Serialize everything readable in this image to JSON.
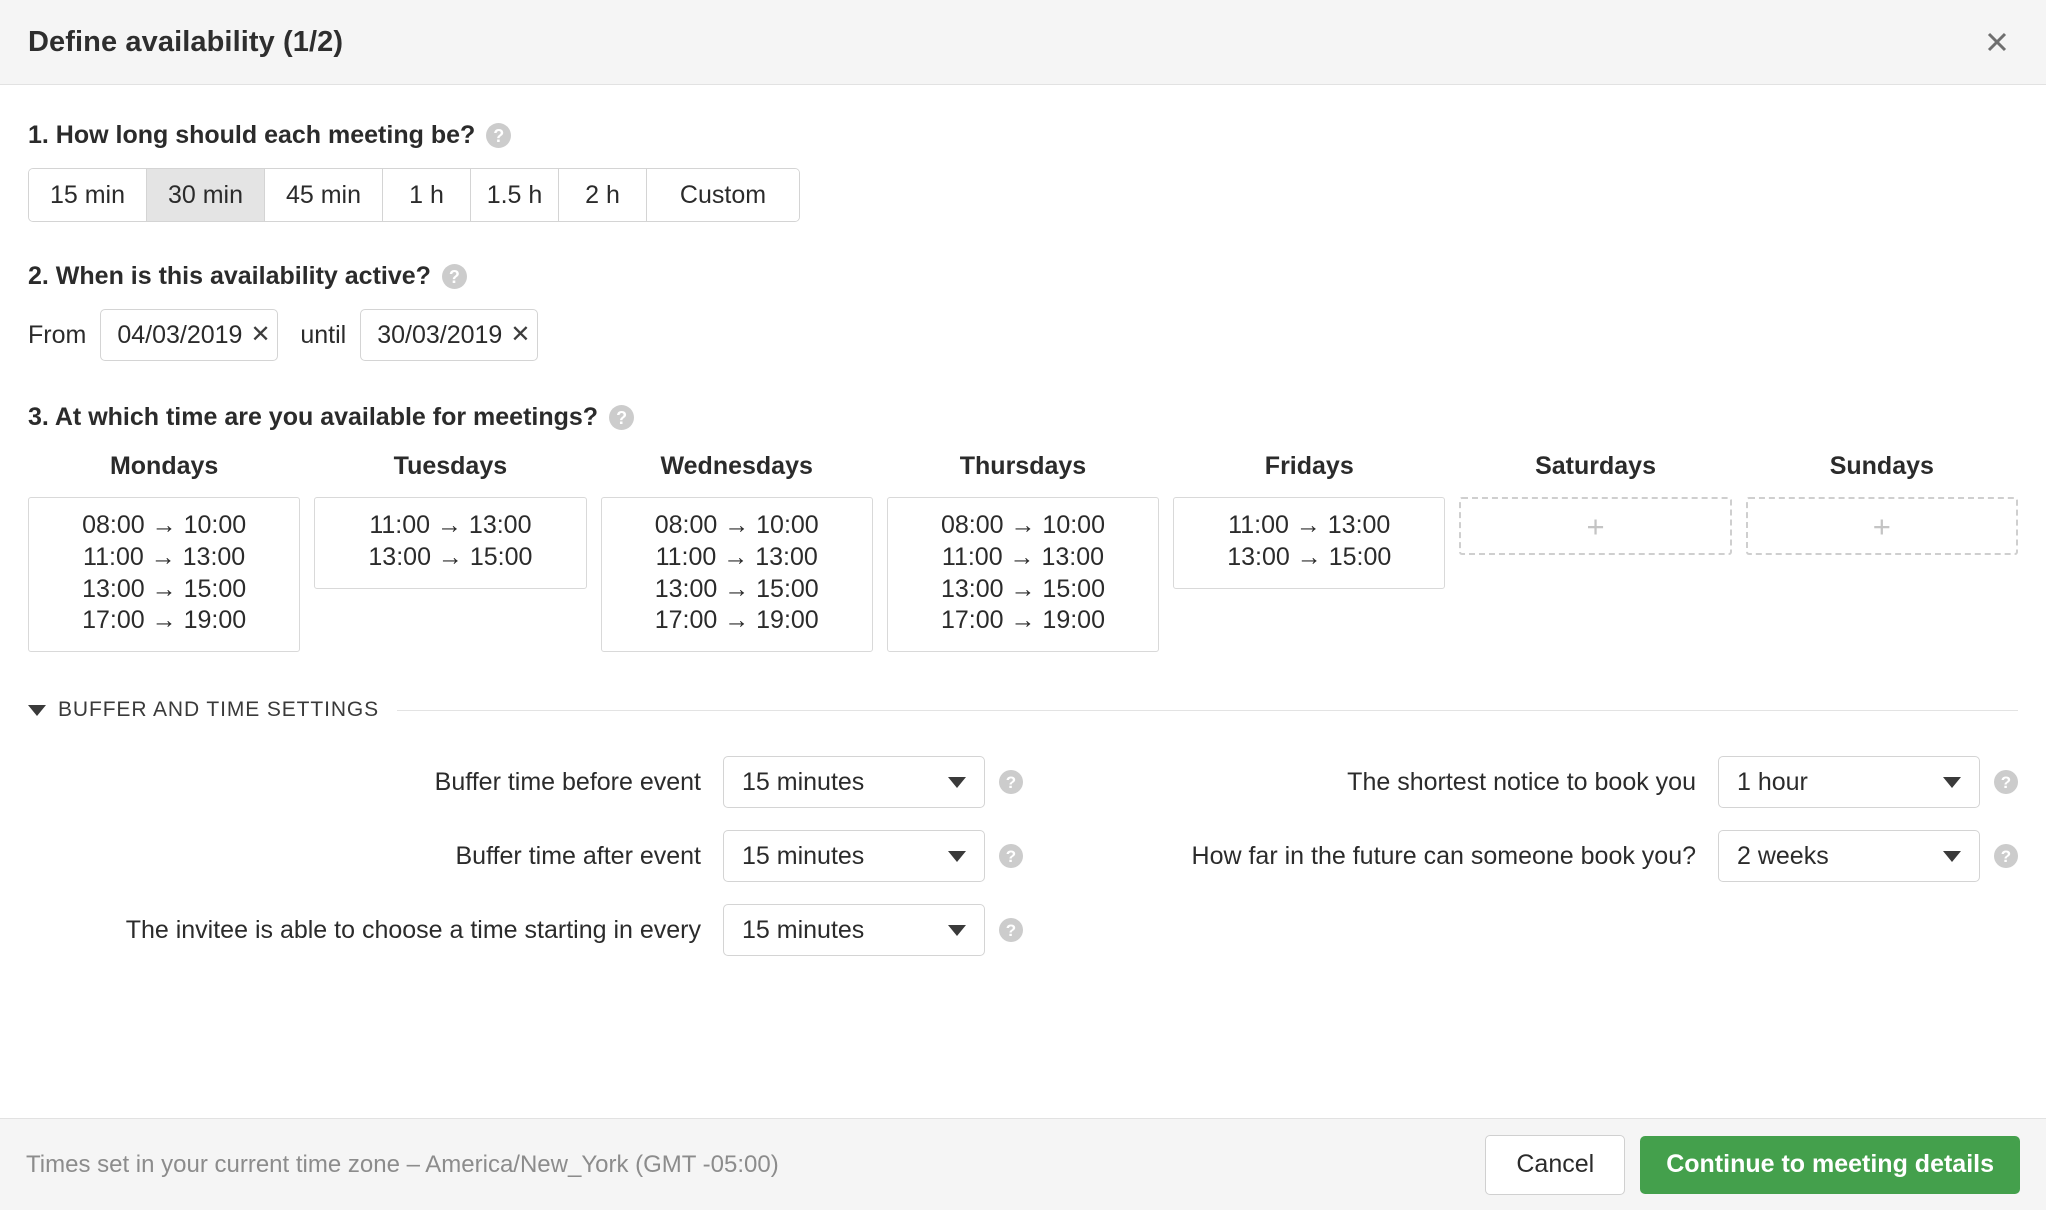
{
  "header": {
    "title": "Define availability (1/2)",
    "close_label": "×"
  },
  "questions": {
    "duration": {
      "text": "1. How long should each meeting be?",
      "options": [
        "15 min",
        "30 min",
        "45 min",
        "1 h",
        "1.5 h",
        "2 h",
        "Custom"
      ],
      "selected": "30 min"
    },
    "active_range": {
      "text": "2. When is this availability active?",
      "from_label": "From",
      "until_label": "until",
      "from_value": "04/03/2019",
      "until_value": "30/03/2019",
      "clear_label": "✕"
    },
    "times": {
      "text": "3. At which time are you available for meetings?"
    }
  },
  "week": [
    {
      "day": "Mondays",
      "slots": [
        "08:00 → 10:00",
        "11:00 → 13:00",
        "13:00 → 15:00",
        "17:00 → 19:00"
      ]
    },
    {
      "day": "Tuesdays",
      "slots": [
        "11:00 → 13:00",
        "13:00 → 15:00"
      ]
    },
    {
      "day": "Wednesdays",
      "slots": [
        "08:00 → 10:00",
        "11:00 → 13:00",
        "13:00 → 15:00",
        "17:00 → 19:00"
      ]
    },
    {
      "day": "Thursdays",
      "slots": [
        "08:00 → 10:00",
        "11:00 → 13:00",
        "13:00 → 15:00",
        "17:00 → 19:00"
      ]
    },
    {
      "day": "Fridays",
      "slots": [
        "11:00 → 13:00",
        "13:00 → 15:00"
      ]
    },
    {
      "day": "Saturdays",
      "slots": [],
      "add_label": "+"
    },
    {
      "day": "Sundays",
      "slots": [],
      "add_label": "+"
    }
  ],
  "buffer_section": {
    "title": "BUFFER AND TIME SETTINGS",
    "left_rows": [
      {
        "label": "Buffer time before event",
        "value": "15 minutes"
      },
      {
        "label": "Buffer time after event",
        "value": "15 minutes"
      },
      {
        "label": "The invitee is able to choose a time starting in every",
        "value": "15 minutes"
      }
    ],
    "right_rows": [
      {
        "label": "The shortest notice to book you",
        "value": "1 hour"
      },
      {
        "label": "How far in the future can someone book you?",
        "value": "2 weeks"
      }
    ]
  },
  "footer": {
    "timezone_note": "Times set in your current time zone – America/New_York (GMT -05:00)",
    "cancel_label": "Cancel",
    "continue_label": "Continue to meeting details"
  },
  "colors": {
    "primary": "#44a04c",
    "header_bg": "#f5f5f5",
    "help_icon": "#cccccc"
  },
  "help_icon_glyph": "?"
}
